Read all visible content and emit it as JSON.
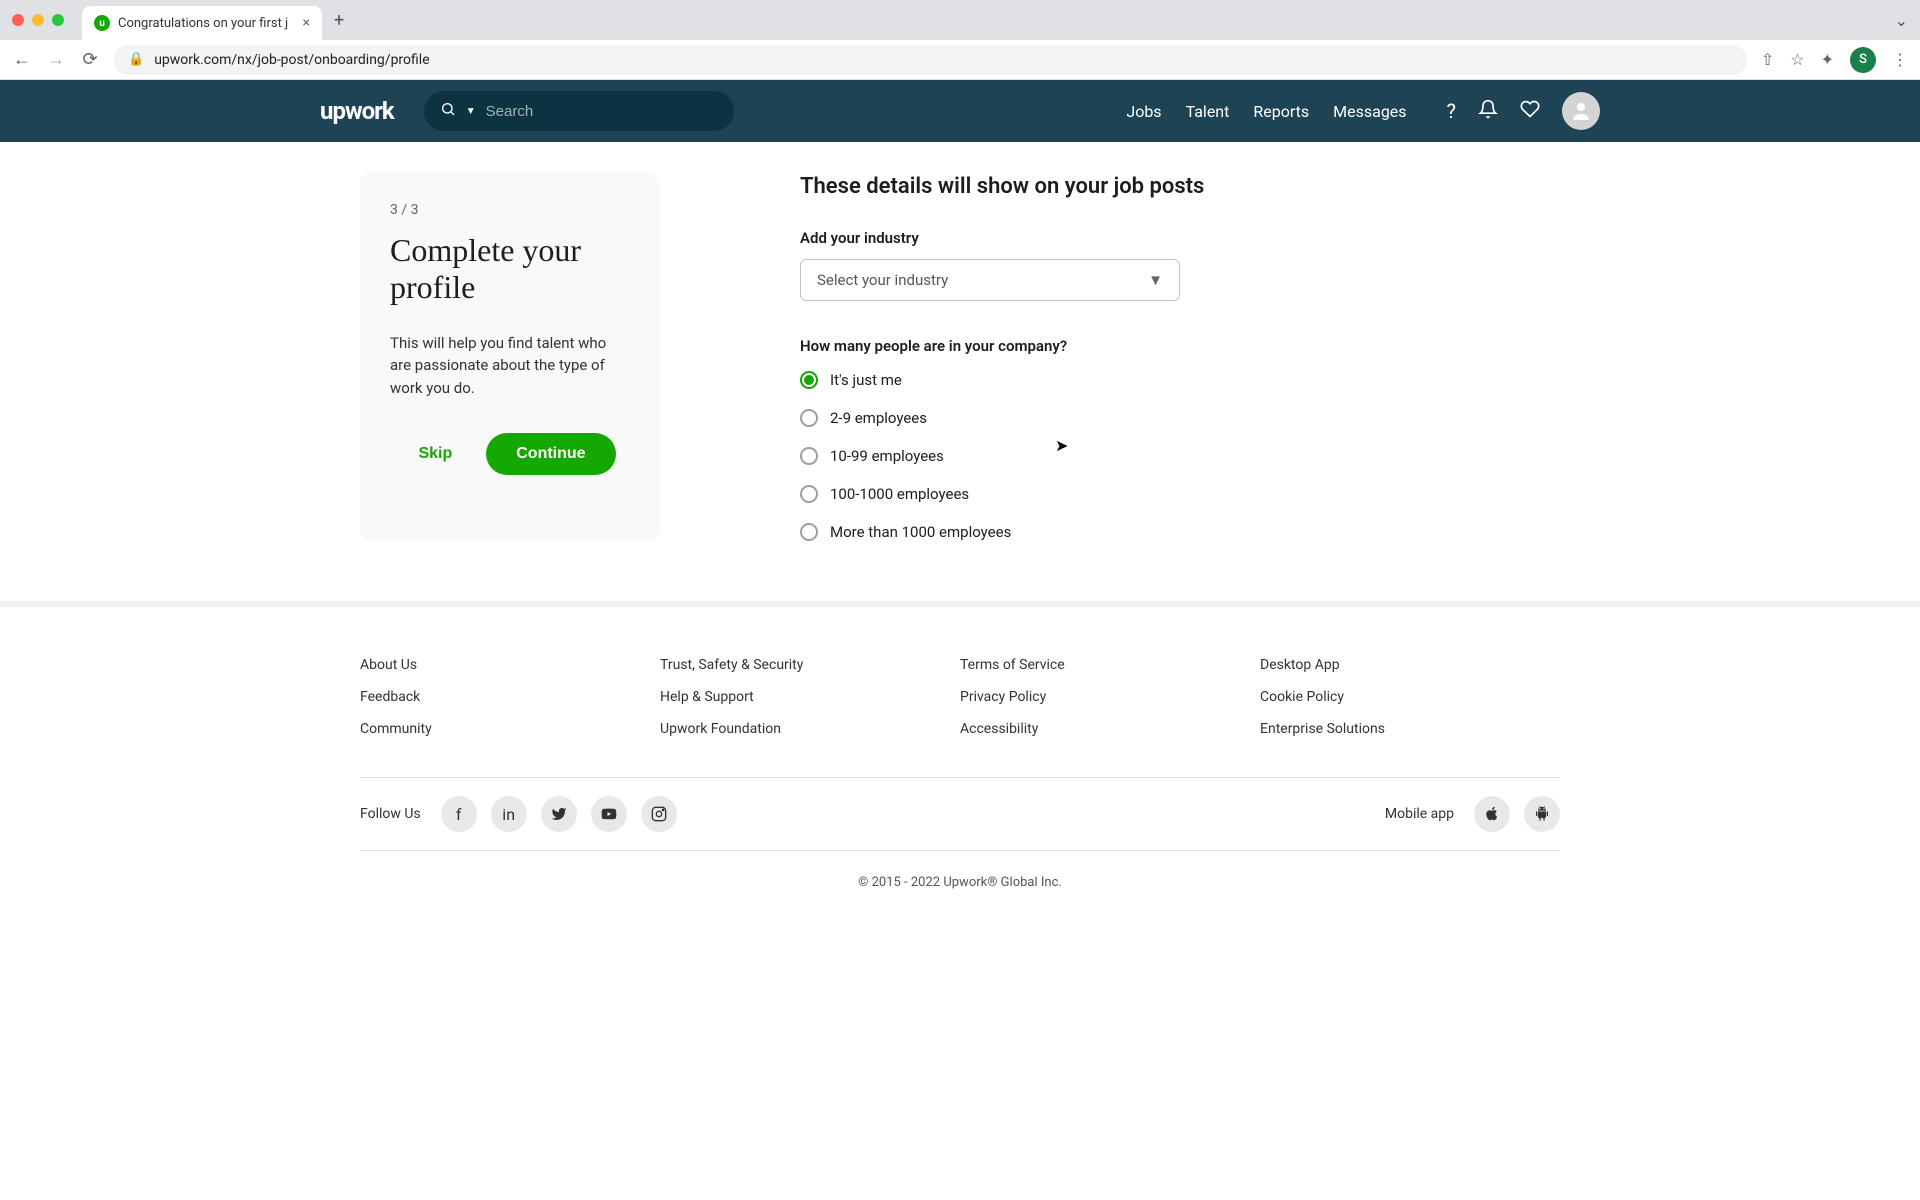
{
  "browser": {
    "tab_title": "Congratulations on your first j",
    "url": "upwork.com/nx/job-post/onboarding/profile",
    "profile_initial": "S"
  },
  "header": {
    "logo": "upwork",
    "search_placeholder": "Search",
    "nav": {
      "jobs": "Jobs",
      "talent": "Talent",
      "reports": "Reports",
      "messages": "Messages"
    }
  },
  "card": {
    "step": "3 / 3",
    "title": "Complete your profile",
    "desc": "This will help you find talent who are passionate about the type of work you do.",
    "skip": "Skip",
    "continue": "Continue"
  },
  "form": {
    "heading": "These details will show on your job posts",
    "industry_label": "Add your industry",
    "industry_placeholder": "Select your industry",
    "company_size_label": "How many people are in your company?",
    "sizes": {
      "0": "It's just me",
      "1": "2-9 employees",
      "2": "10-99 employees",
      "3": "100-1000 employees",
      "4": "More than 1000 employees"
    },
    "selected_index": 0
  },
  "footer": {
    "col1": {
      "0": "About Us",
      "1": "Feedback",
      "2": "Community"
    },
    "col2": {
      "0": "Trust, Safety & Security",
      "1": "Help & Support",
      "2": "Upwork Foundation"
    },
    "col3": {
      "0": "Terms of Service",
      "1": "Privacy Policy",
      "2": "Accessibility"
    },
    "col4": {
      "0": "Desktop App",
      "1": "Cookie Policy",
      "2": "Enterprise Solutions"
    },
    "follow": "Follow Us",
    "mobile": "Mobile app",
    "copyright": "© 2015 - 2022 Upwork® Global Inc."
  }
}
